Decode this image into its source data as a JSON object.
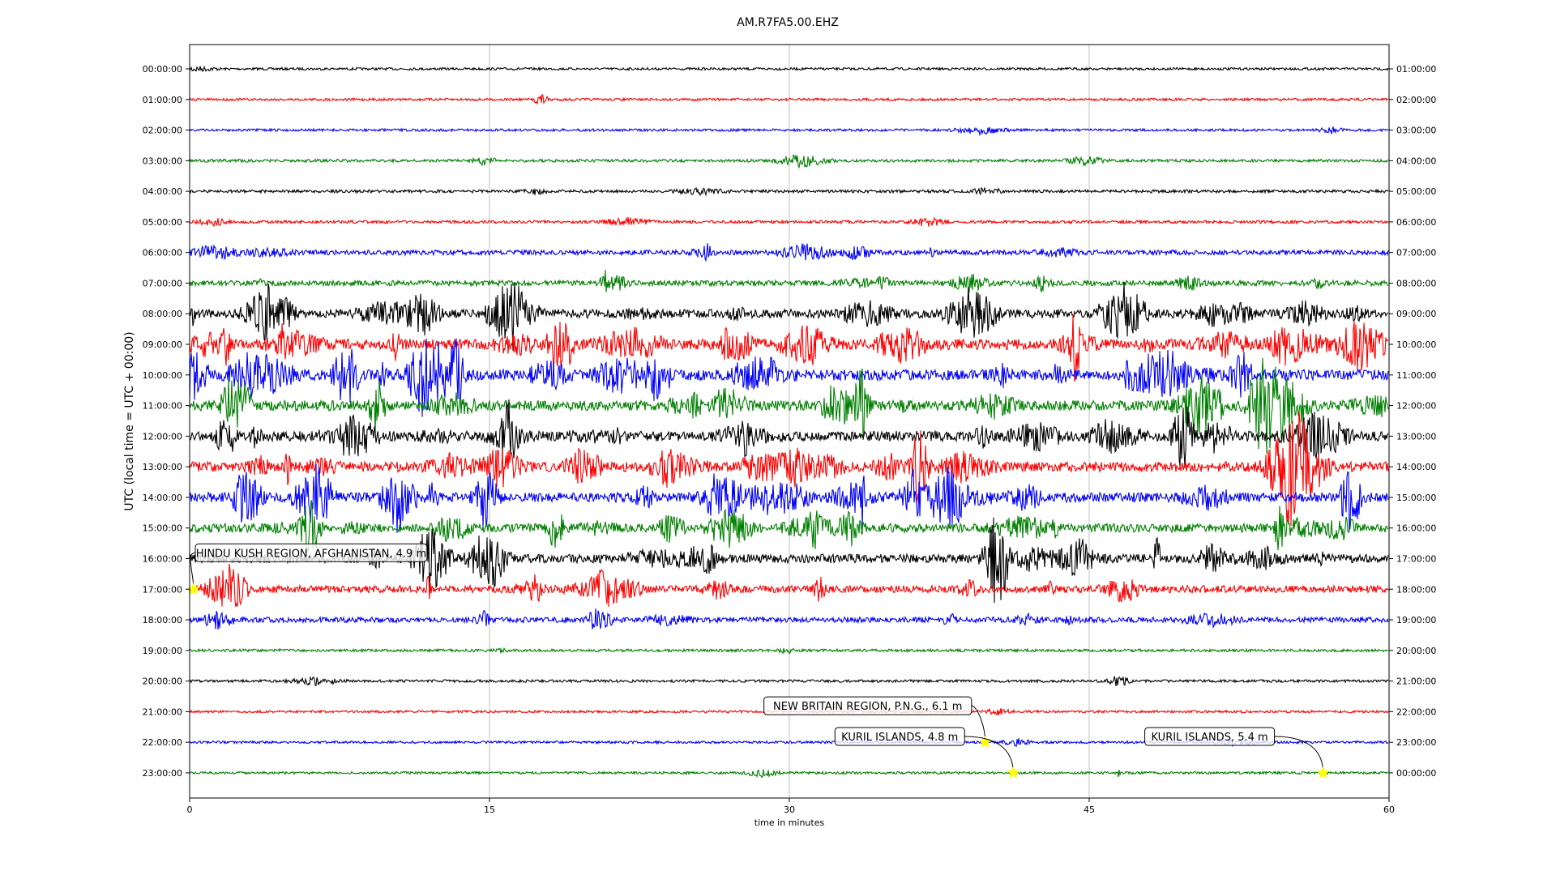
{
  "chart_data": {
    "type": "line",
    "title": "AM.R7FA5.00.EHZ",
    "xlabel": "time in minutes",
    "ylabel": "UTC (local time = UTC + 00:00)",
    "xlim": [
      0,
      60
    ],
    "x_ticks": [
      "0",
      "15",
      "30",
      "45",
      "60"
    ],
    "x_tick_values": [
      0,
      15,
      30,
      45,
      60
    ],
    "vertical_grid": true,
    "left_tick_labels": [
      "00:00:00",
      "01:00:00",
      "02:00:00",
      "03:00:00",
      "04:00:00",
      "05:00:00",
      "06:00:00",
      "07:00:00",
      "08:00:00",
      "09:00:00",
      "10:00:00",
      "11:00:00",
      "12:00:00",
      "13:00:00",
      "14:00:00",
      "15:00:00",
      "16:00:00",
      "17:00:00",
      "18:00:00",
      "19:00:00",
      "20:00:00",
      "21:00:00",
      "22:00:00",
      "23:00:00"
    ],
    "right_tick_labels": [
      "01:00:00",
      "02:00:00",
      "03:00:00",
      "04:00:00",
      "05:00:00",
      "06:00:00",
      "07:00:00",
      "08:00:00",
      "09:00:00",
      "10:00:00",
      "11:00:00",
      "12:00:00",
      "13:00:00",
      "14:00:00",
      "15:00:00",
      "16:00:00",
      "17:00:00",
      "18:00:00",
      "19:00:00",
      "20:00:00",
      "21:00:00",
      "22:00:00",
      "23:00:00",
      "00:00:00"
    ],
    "trace_colors": [
      "#000000",
      "#ff0000",
      "#0000ff",
      "#008000"
    ],
    "trace_activity": [
      0.05,
      0.06,
      0.06,
      0.1,
      0.1,
      0.1,
      0.3,
      0.35,
      0.7,
      0.9,
      0.9,
      0.85,
      0.85,
      0.85,
      0.8,
      0.7,
      0.7,
      0.55,
      0.35,
      0.08,
      0.07,
      0.05,
      0.06,
      0.06
    ],
    "events": [
      {
        "label": "HINDU KUSH REGION, AFGHANISTAN, 4.9 m",
        "row": 17,
        "minute": 0.2
      },
      {
        "label": "NEW BRITAIN REGION, P.N.G., 6.1 m",
        "row": 22,
        "minute": 39.8
      },
      {
        "label": "KURIL ISLANDS, 4.8 m",
        "row": 23,
        "minute": 41.2
      },
      {
        "label": "KURIL ISLANDS, 5.4 m",
        "row": 23,
        "minute": 56.7
      }
    ],
    "event_marker_color": "#ffff00"
  }
}
